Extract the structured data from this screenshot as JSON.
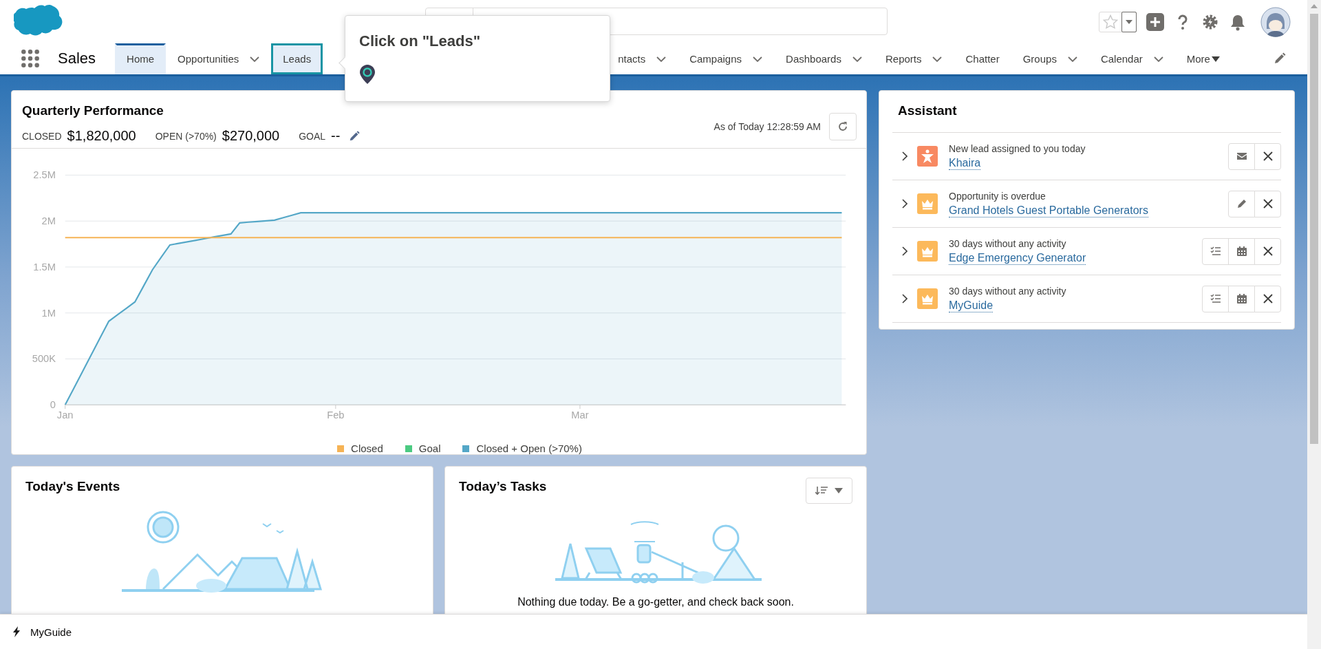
{
  "header": {
    "app_name": "Sales"
  },
  "nav": [
    {
      "kind": "plain",
      "label": "Home",
      "selected": true,
      "highlighted": false
    },
    {
      "kind": "menu",
      "label": "Opportunities",
      "selected": false,
      "highlighted": false
    },
    {
      "kind": "plain",
      "label": "Leads",
      "selected": false,
      "highlighted": true
    },
    {
      "kind": "menu",
      "label": "ntacts",
      "selected": false,
      "highlighted": false,
      "gap_before": true
    },
    {
      "kind": "menu",
      "label": "Campaigns",
      "selected": false,
      "highlighted": false
    },
    {
      "kind": "menu",
      "label": "Dashboards",
      "selected": false,
      "highlighted": false
    },
    {
      "kind": "menu",
      "label": "Reports",
      "selected": false,
      "highlighted": false
    },
    {
      "kind": "plain",
      "label": "Chatter",
      "selected": false,
      "highlighted": false
    },
    {
      "kind": "menu",
      "label": "Groups",
      "selected": false,
      "highlighted": false
    },
    {
      "kind": "menu",
      "label": "Calendar",
      "selected": false,
      "highlighted": false
    },
    {
      "kind": "more",
      "label": "More",
      "selected": false,
      "highlighted": false
    }
  ],
  "guide_tooltip": {
    "title": "Click on \"Leads\""
  },
  "quarterly": {
    "title": "Quarterly Performance",
    "as_of": "As of Today 12:28:59 AM",
    "metrics": [
      {
        "label": "CLOSED",
        "value": "$1,820,000"
      },
      {
        "label": "OPEN (>70%)",
        "value": "$270,000"
      },
      {
        "label": "GOAL",
        "value": "--",
        "editable": true
      }
    ],
    "chart_data": {
      "type": "line",
      "grid": true,
      "legend": "bottom",
      "categories": [
        "Jan",
        null,
        null,
        null,
        null,
        null,
        null,
        null,
        null,
        null,
        null,
        null,
        null,
        null,
        null,
        null,
        null,
        null,
        null,
        null,
        null,
        null,
        null,
        null,
        null,
        null,
        null,
        null,
        null,
        null,
        null,
        "Feb",
        null,
        null,
        null,
        null,
        null,
        null,
        null,
        null,
        null,
        null,
        null,
        null,
        null,
        null,
        null,
        null,
        null,
        null,
        null,
        null,
        null,
        null,
        null,
        null,
        null,
        null,
        null,
        "Mar",
        null,
        null,
        null,
        null,
        null,
        null,
        null,
        null,
        null,
        null,
        null,
        null,
        null,
        null,
        null,
        null,
        null,
        null,
        null,
        null,
        null,
        null,
        null,
        null,
        null,
        null,
        null,
        null,
        null,
        null
      ],
      "ylim": [
        0,
        2500000
      ],
      "yticks": [
        {
          "value": 0,
          "label": "0"
        },
        {
          "value": 500000,
          "label": "500K"
        },
        {
          "value": 1000000,
          "label": "1M"
        },
        {
          "value": 1500000,
          "label": "1.5M"
        },
        {
          "value": 2000000,
          "label": "2M"
        },
        {
          "value": 2500000,
          "label": "2.5M"
        }
      ],
      "series": [
        {
          "name": "Closed",
          "color": "#f6b355",
          "values": [
            1820000,
            1820000,
            1820000,
            1820000,
            1820000,
            1820000,
            1820000,
            1820000,
            1820000,
            1820000,
            1820000,
            1820000,
            1820000,
            1820000,
            1820000,
            1820000,
            1820000,
            1820000,
            1820000,
            1820000,
            1820000,
            1820000,
            1820000,
            1820000,
            1820000,
            1820000,
            1820000,
            1820000,
            1820000,
            1820000,
            1820000,
            1820000,
            1820000,
            1820000,
            1820000,
            1820000,
            1820000,
            1820000,
            1820000,
            1820000,
            1820000,
            1820000,
            1820000,
            1820000,
            1820000,
            1820000,
            1820000,
            1820000,
            1820000,
            1820000,
            1820000,
            1820000,
            1820000,
            1820000,
            1820000,
            1820000,
            1820000,
            1820000,
            1820000,
            1820000,
            1820000,
            1820000,
            1820000,
            1820000,
            1820000,
            1820000,
            1820000,
            1820000,
            1820000,
            1820000,
            1820000,
            1820000,
            1820000,
            1820000,
            1820000,
            1820000,
            1820000,
            1820000,
            1820000,
            1820000,
            1820000,
            1820000,
            1820000,
            1820000,
            1820000,
            1820000,
            1820000,
            1820000,
            1820000,
            1820000
          ]
        },
        {
          "name": "Goal",
          "color": "#4bca81",
          "values": [
            null,
            null,
            null,
            null,
            null,
            null,
            null,
            null,
            null,
            null,
            null,
            null,
            null,
            null,
            null,
            null,
            null,
            null,
            null,
            null,
            null,
            null,
            null,
            null,
            null,
            null,
            null,
            null,
            null,
            null,
            null,
            null,
            null,
            null,
            null,
            null,
            null,
            null,
            null,
            null,
            null,
            null,
            null,
            null,
            null,
            null,
            null,
            null,
            null,
            null,
            null,
            null,
            null,
            null,
            null,
            null,
            null,
            null,
            null,
            null,
            null,
            null,
            null,
            null,
            null,
            null,
            null,
            null,
            null,
            null,
            null,
            null,
            null,
            null,
            null,
            null,
            null,
            null,
            null,
            null,
            null,
            null,
            null,
            null,
            null,
            null,
            null,
            null,
            null,
            null
          ]
        },
        {
          "name": "Closed + Open (>70%)",
          "color": "#54a7c7",
          "values": [
            0,
            182000,
            364000,
            546000,
            728000,
            910000,
            980000,
            1050000,
            1120000,
            1295000,
            1470000,
            1605000,
            1740000,
            1757000,
            1774000,
            1791000,
            1809000,
            1826000,
            1843000,
            1860000,
            1980000,
            1988000,
            1995000,
            2003000,
            2010000,
            2037000,
            2063000,
            2090000,
            2090000,
            2090000,
            2090000,
            2090000,
            2090000,
            2090000,
            2090000,
            2090000,
            2090000,
            2090000,
            2090000,
            2090000,
            2090000,
            2090000,
            2090000,
            2090000,
            2090000,
            2090000,
            2090000,
            2090000,
            2090000,
            2090000,
            2090000,
            2090000,
            2090000,
            2090000,
            2090000,
            2090000,
            2090000,
            2090000,
            2090000,
            2090000,
            2090000,
            2090000,
            2090000,
            2090000,
            2090000,
            2090000,
            2090000,
            2090000,
            2090000,
            2090000,
            2090000,
            2090000,
            2090000,
            2090000,
            2090000,
            2090000,
            2090000,
            2090000,
            2090000,
            2090000,
            2090000,
            2090000,
            2090000,
            2090000,
            2090000,
            2090000,
            2090000,
            2090000,
            2090000,
            2090000
          ]
        }
      ]
    }
  },
  "assistant": {
    "title": "Assistant",
    "items": [
      {
        "kind": "lead",
        "message": "New lead assigned to you today",
        "link": "Khaira",
        "actions": [
          {
            "kind": "email"
          },
          {
            "kind": "close"
          }
        ]
      },
      {
        "kind": "opportunity",
        "message": "Opportunity is overdue",
        "link": "Grand Hotels Guest Portable Generators",
        "actions": [
          {
            "kind": "edit"
          },
          {
            "kind": "close"
          }
        ]
      },
      {
        "kind": "opportunity",
        "message": "30 days without any activity",
        "link": "Edge Emergency Generator",
        "actions": [
          {
            "kind": "task"
          },
          {
            "kind": "event"
          },
          {
            "kind": "close"
          }
        ]
      },
      {
        "kind": "opportunity",
        "message": "30 days without any activity",
        "link": "MyGuide",
        "actions": [
          {
            "kind": "task"
          },
          {
            "kind": "event"
          },
          {
            "kind": "close"
          }
        ]
      }
    ]
  },
  "events": {
    "title": "Today's Events"
  },
  "tasks": {
    "title": "Today’s Tasks",
    "message": "Nothing due today. Be a go-getter, and check back soon."
  },
  "footer": {
    "label": "MyGuide"
  }
}
